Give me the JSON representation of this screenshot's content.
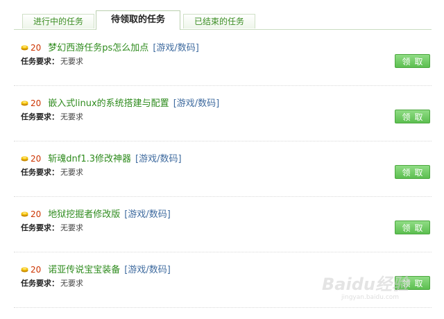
{
  "tabs": [
    {
      "label": "进行中的任务",
      "active": false
    },
    {
      "label": "待领取的任务",
      "active": true
    },
    {
      "label": "已结束的任务",
      "active": false
    }
  ],
  "requirement_label": "任务要求：",
  "claim_label": "领取",
  "tasks": [
    {
      "reward": "20",
      "title": "梦幻西游任务ps怎么加点",
      "category": "[游戏/数码]",
      "requirement": "无要求"
    },
    {
      "reward": "20",
      "title": "嵌入式linux的系统搭建与配置",
      "category": "[游戏/数码]",
      "requirement": "无要求"
    },
    {
      "reward": "20",
      "title": "斩魂dnf1.3修改神器",
      "category": "[游戏/数码]",
      "requirement": "无要求"
    },
    {
      "reward": "20",
      "title": "地狱挖掘者修改版",
      "category": "[游戏/数码]",
      "requirement": "无要求"
    },
    {
      "reward": "20",
      "title": "诺亚传说宝宝装备",
      "category": "[游戏/数码]",
      "requirement": "无要求"
    }
  ],
  "watermark": {
    "text": "Baidu经验",
    "sub": "jingyan.baidu.com"
  },
  "colors": {
    "accent_green": "#2e8b1d",
    "reward_red": "#cc3300",
    "category_blue": "#3f6b9f",
    "button_green": "#5cbf50",
    "coin_gold": "#e0a800"
  }
}
